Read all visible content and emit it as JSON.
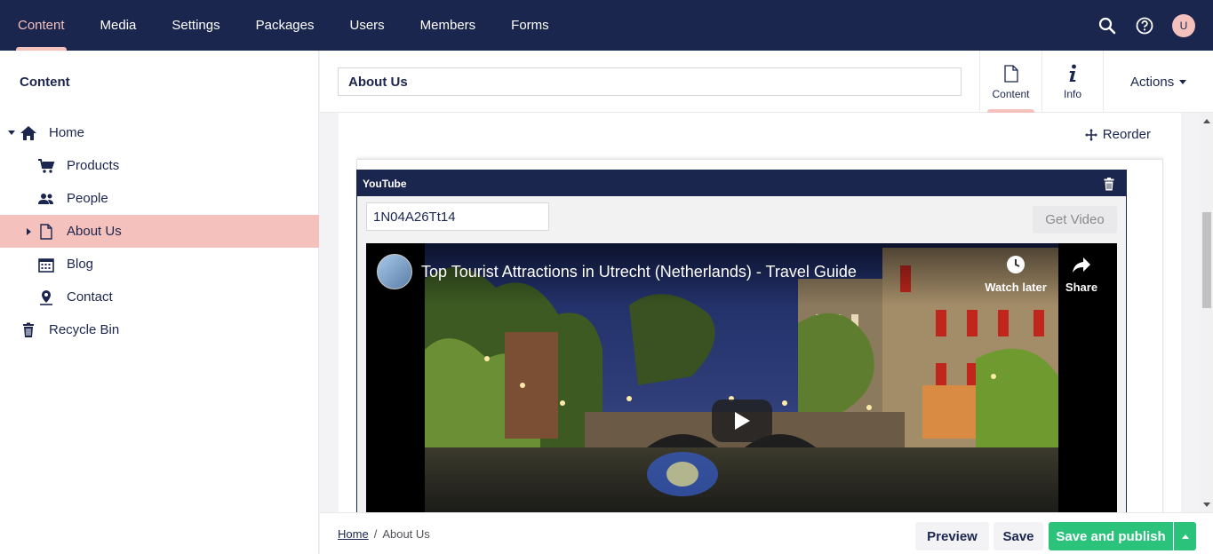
{
  "topnav": {
    "items": [
      {
        "label": "Content",
        "active": true
      },
      {
        "label": "Media",
        "active": false
      },
      {
        "label": "Settings",
        "active": false
      },
      {
        "label": "Packages",
        "active": false
      },
      {
        "label": "Users",
        "active": false
      },
      {
        "label": "Members",
        "active": false
      },
      {
        "label": "Forms",
        "active": false
      }
    ],
    "icons": [
      "search-icon",
      "help-icon"
    ],
    "avatar_initial": "U"
  },
  "sidebar": {
    "title": "Content",
    "tree": [
      {
        "label": "Home",
        "icon": "home-icon",
        "expanded": true
      },
      {
        "label": "Products",
        "icon": "shopping-cart-icon"
      },
      {
        "label": "People",
        "icon": "people-icon"
      },
      {
        "label": "About Us",
        "icon": "document-icon",
        "selected": true
      },
      {
        "label": "Blog",
        "icon": "calendar-icon"
      },
      {
        "label": "Contact",
        "icon": "map-pin-icon"
      },
      {
        "label": "Recycle Bin",
        "icon": "trash-icon"
      }
    ]
  },
  "editor": {
    "node_name": "About Us",
    "apps": [
      {
        "label": "Content",
        "icon": "document-icon",
        "active": true
      },
      {
        "label": "Info",
        "icon": "info-icon",
        "active": false
      }
    ],
    "actions_label": "Actions"
  },
  "content": {
    "reorder_label": "Reorder",
    "block": {
      "title": "YouTube",
      "video_id": "1N04A26Tt14",
      "get_video_label": "Get Video",
      "video_title": "Top Tourist Attractions in Utrecht (Netherlands) - Travel Guide",
      "watch_later_label": "Watch later",
      "share_label": "Share"
    }
  },
  "footer": {
    "breadcrumb": [
      "Home",
      "About Us"
    ],
    "separator": "/",
    "preview_label": "Preview",
    "save_label": "Save",
    "publish_label": "Save and publish"
  },
  "colors": {
    "navy": "#1b264f",
    "pink": "#f5c1bc",
    "green": "#2bc37c"
  }
}
